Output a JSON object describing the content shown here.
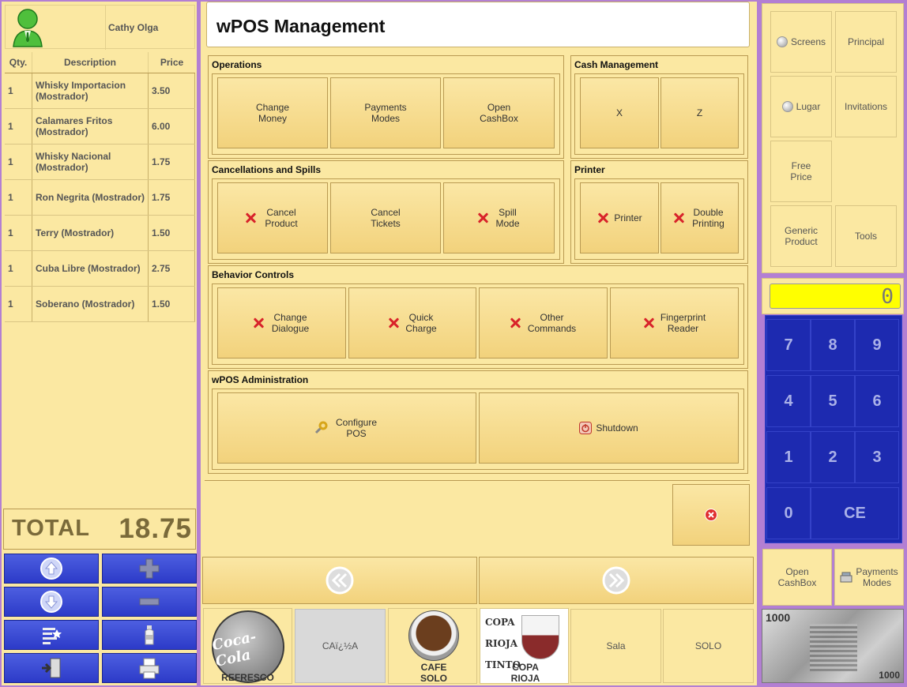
{
  "user": {
    "name": "Cathy Olga"
  },
  "ticket": {
    "headers": {
      "qty": "Qty.",
      "desc": "Description",
      "price": "Price"
    },
    "rows": [
      {
        "qty": "1",
        "desc": "Whisky Importacion (Mostrador)",
        "price": "3.50"
      },
      {
        "qty": "1",
        "desc": "Calamares Fritos (Mostrador)",
        "price": "6.00"
      },
      {
        "qty": "1",
        "desc": "Whisky Nacional (Mostrador)",
        "price": "1.75"
      },
      {
        "qty": "1",
        "desc": "Ron Negrita (Mostrador)",
        "price": "1.75"
      },
      {
        "qty": "1",
        "desc": "Terry (Mostrador)",
        "price": "1.50"
      },
      {
        "qty": "1",
        "desc": "Cuba Libre (Mostrador)",
        "price": "2.75"
      },
      {
        "qty": "1",
        "desc": "Soberano (Mostrador)",
        "price": "1.50"
      }
    ],
    "total_label": "TOTAL",
    "total_value": "18.75"
  },
  "header": {
    "title": "wPOS Management"
  },
  "operations": {
    "title": "Operations",
    "change_money": "Change Money",
    "payments_modes": "Payments Modes",
    "open_cashbox": "Open CashBox"
  },
  "cash_management": {
    "title": "Cash Management",
    "x": "X",
    "z": "Z"
  },
  "cancellations": {
    "title": "Cancellations and Spills",
    "cancel_product": "Cancel Product",
    "cancel_tickets": "Cancel Tickets",
    "spill_mode": "Spill Mode"
  },
  "printer": {
    "title": "Printer",
    "printer": "Printer",
    "double_printing": "Double Printing"
  },
  "behavior": {
    "title": "Behavior Controls",
    "change_dialogue": "Change Dialogue",
    "quick_charge": "Quick Charge",
    "other_commands": "Other Commands",
    "fingerprint_reader": "Fingerprint Reader"
  },
  "admin": {
    "title": "wPOS Administration",
    "configure_pos": "Configure POS",
    "shutdown": "Shutdown"
  },
  "products": [
    {
      "label": "REFRESCO",
      "image_text": "Coca-Cola"
    },
    {
      "label": "CAï¿½A"
    },
    {
      "label": "CAFE SOLO"
    },
    {
      "label": "COPA RIOJA",
      "image_text": "COPA RIOJA TINTO"
    },
    {
      "label": "Sala"
    },
    {
      "label": "SOLO"
    }
  ],
  "right_menu": {
    "screens": "Screens",
    "principal": "Principal",
    "lugar": "Lugar",
    "invitations": "Invitations",
    "free_price": "Free Price",
    "generic_product": "Generic Product",
    "tools": "Tools"
  },
  "display": {
    "value": "0"
  },
  "keypad": [
    "7",
    "8",
    "9",
    "4",
    "5",
    "6",
    "1",
    "2",
    "3",
    "0",
    "CE"
  ],
  "bottom_right": {
    "open_cashbox": "Open CashBox",
    "payments_modes": "Payments Modes",
    "banknote_value": "1000"
  },
  "colors": {
    "panel": "#fbe8a2",
    "border": "#b37fd3",
    "keypad": "#1d2ab0",
    "display": "#ffff00"
  }
}
